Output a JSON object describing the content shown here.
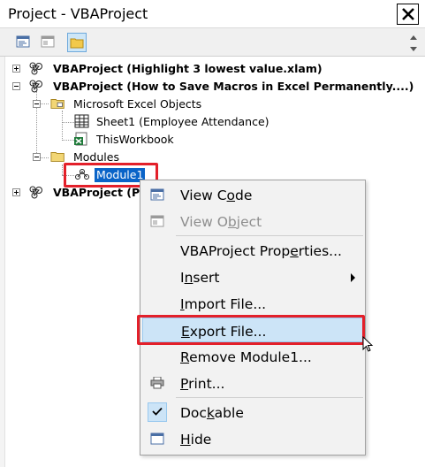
{
  "window": {
    "title": "Project - VBAProject",
    "close_glyph": "✕"
  },
  "toolbar": {
    "buttons": [
      {
        "name": "view-code-icon"
      },
      {
        "name": "view-object-icon"
      },
      {
        "name": "toggle-folders-icon"
      }
    ]
  },
  "tree": {
    "project1": "VBAProject (Highlight 3 lowest value.xlam)",
    "project2": "VBAProject (How to Save Macros in Excel Permanently....)",
    "excel_objects": "Microsoft Excel Objects",
    "sheet1": "Sheet1 (Employee Attendance)",
    "thisworkbook": "ThisWorkbook",
    "modules": "Modules",
    "module1": "Module1",
    "project3": "VBAProject (PE"
  },
  "context_menu": {
    "view_code": {
      "before": "View C",
      "ul": "o",
      "after": "de"
    },
    "view_object": {
      "before": "View O",
      "ul": "b",
      "after": "ject"
    },
    "vbaproject_properties": {
      "before": "VBAProject Prop",
      "ul": "e",
      "after": "rties..."
    },
    "insert": {
      "before": "I",
      "ul": "n",
      "after": "sert"
    },
    "import_file": {
      "before": "",
      "ul": "I",
      "after": "mport File..."
    },
    "export_file": {
      "before": "",
      "ul": "E",
      "after": "xport File..."
    },
    "remove_module": {
      "before": "",
      "ul": "R",
      "after": "emove Module1..."
    },
    "print": {
      "before": "",
      "ul": "P",
      "after": "rint..."
    },
    "dockable": {
      "before": "Doc",
      "ul": "k",
      "after": "able"
    },
    "hide": {
      "before": "",
      "ul": "H",
      "after": "ide"
    }
  },
  "colors": {
    "highlight_red": "#e3202a",
    "selection_blue": "#0a64c8",
    "menu_hover": "#cce4f7"
  }
}
